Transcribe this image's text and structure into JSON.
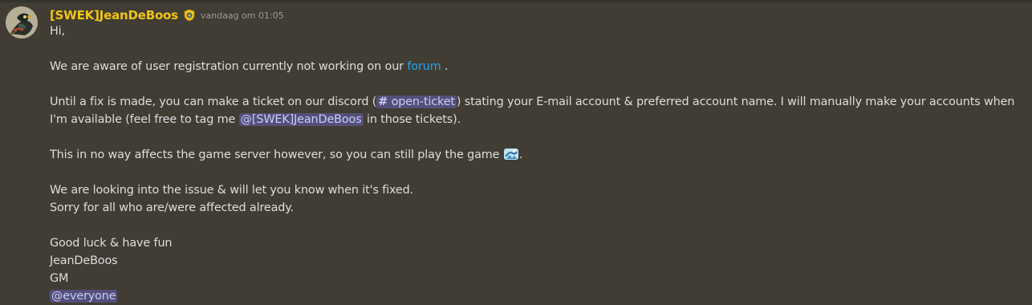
{
  "message": {
    "author": "[SWEK]JeanDeBoos",
    "timestamp": "vandaag om 01:05",
    "badge_icon": "police-badge-icon",
    "avatar_icon": "bird-avatar-icon",
    "line_greeting": "Hi,",
    "p1_before": "We are aware of user registration currently not working on our ",
    "p1_link": "forum",
    "p1_after": " .",
    "p2_before": "Until a fix is made, you can make a ticket on our discord (",
    "p2_channel_hash": "#",
    "p2_channel": "open-ticket",
    "p2_mid": ") stating your E-mail account & preferred account name. I will manually make your accounts when I'm available (feel free to tag me ",
    "p2_mention": "@[SWEK]JeanDeBoos",
    "p2_after": " in those tickets).",
    "p3_before": "This in no way affects the game server however, so you can still play the game ",
    "p3_emoji": "game-emoji-icon",
    "p3_after": ".",
    "p4_line1": "We are looking into the issue & will let you know when it's fixed.",
    "p4_line2": "Sorry for all who are/were affected already.",
    "sig_line1": "Good luck & have fun",
    "sig_line2": "JeanDeBoos",
    "sig_line3": "GM",
    "everyone_mention": "@everyone"
  },
  "colors": {
    "background": "#413d34",
    "username": "#f0c419",
    "link": "#1ea7f0",
    "mention_bg": "#54507a",
    "mention_text": "#c9cdfb"
  }
}
